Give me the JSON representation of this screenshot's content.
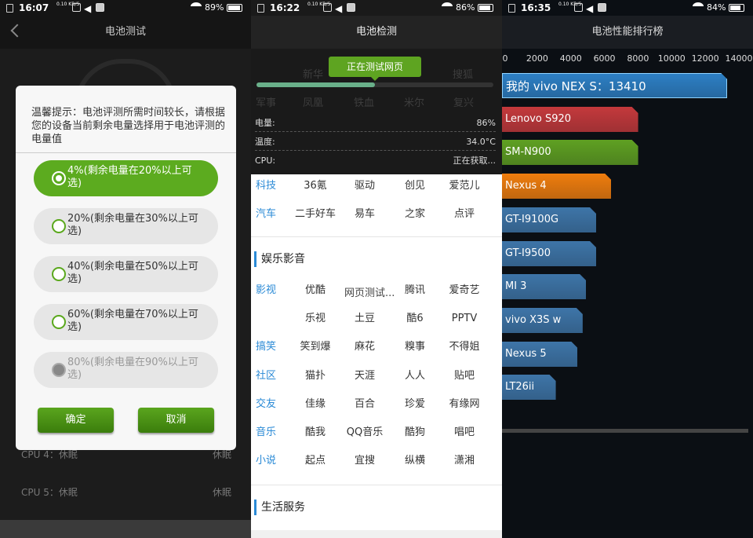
{
  "p1": {
    "time": "16:07",
    "speed": "0.10\nKB/S",
    "battery": "89%",
    "title": "电池测试",
    "dialog": {
      "message": "温馨提示：电池评测所需时间较长，请根据您的设备当前剩余电量选择用于电池评测的电量值",
      "options": [
        "4%(剩余电量在20%以上可选)",
        "20%(剩余电量在30%以上可选)",
        "40%(剩余电量在50%以上可选)",
        "60%(剩余电量在70%以上可选)",
        "80%(剩余电量在90%以上可选)"
      ],
      "ok": "确定",
      "cancel": "取消"
    },
    "rows": [
      {
        "label": "CPU 4：休眠",
        "value": "休眠"
      },
      {
        "label": "CPU 5：休眠",
        "value": "休眠"
      }
    ]
  },
  "p2": {
    "time": "16:22",
    "speed": "0.10\nKB/S",
    "battery": "86%",
    "title": "电池检测",
    "tip": "正在测试网页",
    "progress": 0.5,
    "info": [
      {
        "label": "电量:",
        "value": "86%"
      },
      {
        "label": "温度:",
        "value": "34.0°C"
      },
      {
        "label": "CPU:",
        "value": "正在获取..."
      }
    ],
    "ghost": [
      "新华",
      "网易",
      "腾讯",
      "新浪",
      "搜狐",
      "军事",
      "凤凰",
      "铁血",
      "米尔",
      "复兴"
    ],
    "rows": [
      {
        "cat": "科技",
        "items": [
          "36氪",
          "驱动",
          "创见",
          "爱范儿"
        ]
      },
      {
        "cat": "汽车",
        "items": [
          "二手好车",
          "易车",
          "之家",
          "点评"
        ]
      }
    ],
    "section1": "娱乐影音",
    "rows2": [
      {
        "cat": "影视",
        "items": [
          "优酷",
          "",
          "腾讯",
          "爱奇艺"
        ]
      },
      {
        "cat": "",
        "items": [
          "乐视",
          "土豆",
          "酷6",
          "PPTV"
        ]
      },
      {
        "cat": "搞笑",
        "items": [
          "笑到爆",
          "麻花",
          "糗事",
          "不得姐"
        ]
      },
      {
        "cat": "社区",
        "items": [
          "猫扑",
          "天涯",
          "人人",
          "贴吧"
        ]
      },
      {
        "cat": "交友",
        "items": [
          "佳缘",
          "百合",
          "珍爱",
          "有缘网"
        ]
      },
      {
        "cat": "音乐",
        "items": [
          "酷我",
          "QQ音乐",
          "酷狗",
          "唱吧"
        ]
      },
      {
        "cat": "小说",
        "items": [
          "起点",
          "宜搜",
          "纵横",
          "潇湘"
        ]
      }
    ],
    "overlay": "网页测试...",
    "section2": "生活服务"
  },
  "p3": {
    "time": "16:35",
    "speed": "0.10\nKB/S",
    "battery": "84%",
    "title": "电池性能排行榜",
    "chart_data": {
      "type": "bar",
      "orientation": "horizontal",
      "xlim": [
        0,
        14000
      ],
      "ticks": [
        0,
        2000,
        4000,
        6000,
        8000,
        10000,
        12000,
        14000
      ],
      "categories": [
        "我的 vivo NEX S：13410",
        "Lenovo S920",
        "SM-N900",
        "Nexus 4",
        "GT-I9100G",
        "GT-I9500",
        "MI 3",
        "vivo X3S w",
        "Nexus 5",
        "LT26ii"
      ],
      "values": [
        13410,
        8100,
        8100,
        6500,
        5600,
        5600,
        5000,
        4800,
        4500,
        3200
      ],
      "colors": [
        "#2d7fc4",
        "#c4393c",
        "#5fa022",
        "#ef7d0e",
        "#3e75a8",
        "#3e75a8",
        "#3e75a8",
        "#3e75a8",
        "#3e75a8",
        "#3e75a8"
      ]
    }
  }
}
